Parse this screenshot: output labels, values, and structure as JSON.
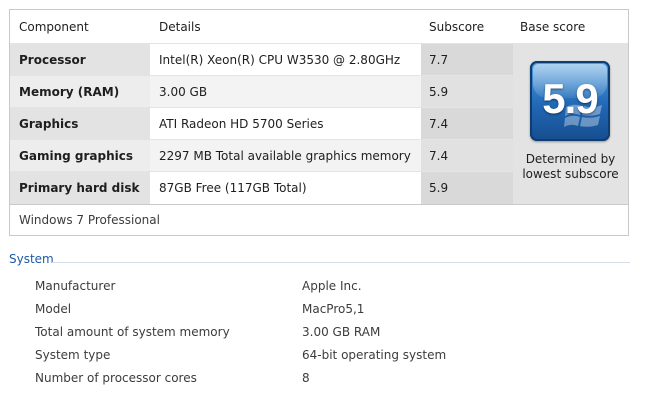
{
  "wei": {
    "headers": {
      "component": "Component",
      "details": "Details",
      "subscore": "Subscore",
      "base_score": "Base score"
    },
    "rows": [
      {
        "component": "Processor",
        "details": "Intel(R) Xeon(R) CPU W3530 @ 2.80GHz",
        "subscore": "7.7"
      },
      {
        "component": "Memory (RAM)",
        "details": "3.00 GB",
        "subscore": "5.9"
      },
      {
        "component": "Graphics",
        "details": "ATI Radeon HD 5700 Series",
        "subscore": "7.4"
      },
      {
        "component": "Gaming graphics",
        "details": "2297 MB Total available graphics memory",
        "subscore": "7.4"
      },
      {
        "component": "Primary hard disk",
        "details": "87GB Free (117GB Total)",
        "subscore": "5.9"
      }
    ],
    "base_score": "5.9",
    "determined_by": "Determined by lowest subscore",
    "edition": "Windows 7 Professional"
  },
  "system": {
    "title": "System",
    "items": [
      {
        "label": "Manufacturer",
        "value": "Apple Inc."
      },
      {
        "label": "Model",
        "value": "MacPro5,1"
      },
      {
        "label": "Total amount of system memory",
        "value": "3.00 GB RAM"
      },
      {
        "label": "System type",
        "value": "64-bit operating system"
      },
      {
        "label": "Number of processor cores",
        "value": "8"
      }
    ]
  },
  "colors": {
    "section_title": "#1e5aa8",
    "badge_blue": "#2168b6"
  }
}
